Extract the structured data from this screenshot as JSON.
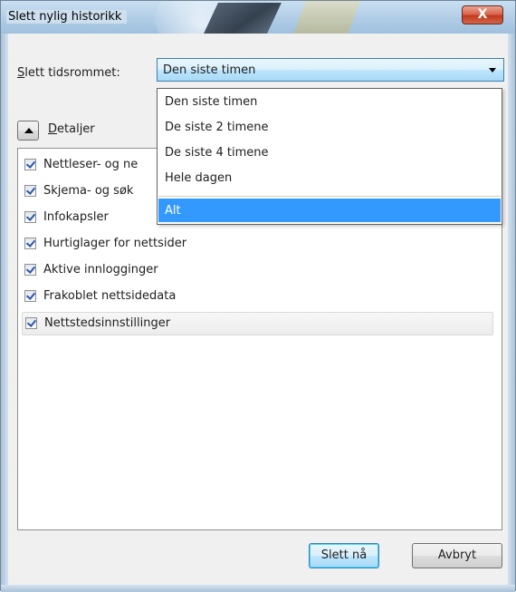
{
  "window": {
    "title": "Slett nylig historikk",
    "close_symbol": "X"
  },
  "time_range": {
    "label_prefix": "S",
    "label_rest": "lett tidsrommet:",
    "selected": "Den siste timen",
    "options": [
      "Den siste timen",
      "De siste 2 timene",
      "De siste 4 timene",
      "Hele dagen",
      "Alt"
    ],
    "highlighted_index": 4
  },
  "details": {
    "label_prefix": "D",
    "label_rest": "etaljer"
  },
  "items": [
    {
      "label": "Nettleser- og nedlastingshistorikk",
      "visible": "Nettleser- og ne",
      "checked": true
    },
    {
      "label": "Skjema- og søkehistorikk",
      "visible": "Skjema- og søk",
      "checked": true
    },
    {
      "label": "Infokapsler",
      "visible": "Infokapsler",
      "checked": true
    },
    {
      "label": "Hurtiglager for nettsider",
      "visible": "Hurtiglager for nettsider",
      "checked": true
    },
    {
      "label": "Aktive innlogginger",
      "visible": "Aktive innlogginger",
      "checked": true
    },
    {
      "label": "Frakoblet nettsidedata",
      "visible": "Frakoblet nettsidedata",
      "checked": true
    },
    {
      "label": "Nettstedsinnstillinger",
      "visible": "Nettstedsinnstillinger",
      "checked": true
    }
  ],
  "buttons": {
    "clear_now": "Slett nå",
    "cancel": "Avbryt"
  },
  "colors": {
    "highlight": "#3399ff",
    "title_bg": "#b5d0e8",
    "close_red": "#c2391e"
  }
}
